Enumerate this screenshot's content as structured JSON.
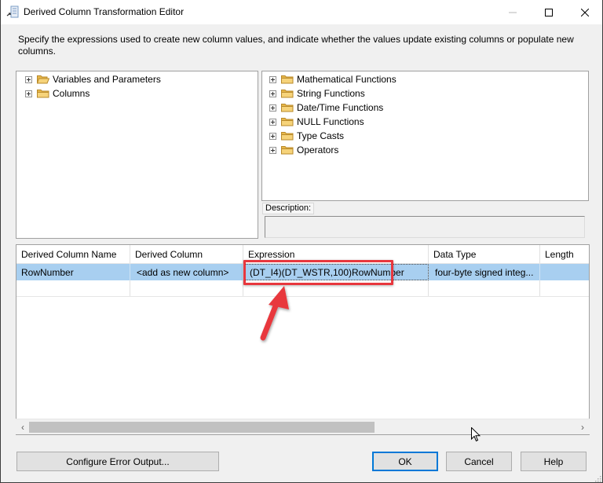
{
  "window": {
    "title": "Derived Column Transformation Editor",
    "icon": "derived-column-icon",
    "controls": {
      "minimize_glyph": "—",
      "maximize_glyph": "☐",
      "close_glyph": "✕"
    }
  },
  "intro_text": "Specify the expressions used to create new column values, and indicate whether the values update existing columns or populate new columns.",
  "left_tree": {
    "items": [
      {
        "label": "Variables and Parameters",
        "icon": "folder-open-icon",
        "expander": "plus"
      },
      {
        "label": "Columns",
        "icon": "folder-icon",
        "expander": "plus"
      }
    ]
  },
  "right_tree": {
    "items": [
      {
        "label": "Mathematical Functions",
        "icon": "folder-icon",
        "expander": "plus"
      },
      {
        "label": "String Functions",
        "icon": "folder-icon",
        "expander": "plus"
      },
      {
        "label": "Date/Time Functions",
        "icon": "folder-icon",
        "expander": "plus"
      },
      {
        "label": "NULL Functions",
        "icon": "folder-icon",
        "expander": "plus"
      },
      {
        "label": "Type Casts",
        "icon": "folder-icon",
        "expander": "plus"
      },
      {
        "label": "Operators",
        "icon": "folder-icon",
        "expander": "plus"
      }
    ]
  },
  "description": {
    "label": "Description:",
    "value": ""
  },
  "grid": {
    "columns": [
      "Derived Column Name",
      "Derived Column",
      "Expression",
      "Data Type",
      "Length"
    ],
    "rows": [
      {
        "selected": true,
        "cells": [
          "RowNumber",
          "<add as new column>",
          "(DT_I4)(DT_WSTR,100)RowNumber",
          "four-byte signed integ...",
          ""
        ]
      },
      {
        "selected": false,
        "cells": [
          "",
          "",
          "",
          "",
          ""
        ]
      }
    ],
    "scrollbar": {
      "left_glyph": "‹",
      "right_glyph": "›",
      "visible_fraction": 0.62
    }
  },
  "annotation": {
    "highlight_color": "#e8373e",
    "target": "Expression cell"
  },
  "buttons": {
    "configure_error_output": "Configure Error Output...",
    "ok": "OK",
    "cancel": "Cancel",
    "help": "Help"
  },
  "colors": {
    "selection": "#a8cff0",
    "default_button_border": "#0078d7",
    "dialog_bg": "#f0f0f0"
  }
}
